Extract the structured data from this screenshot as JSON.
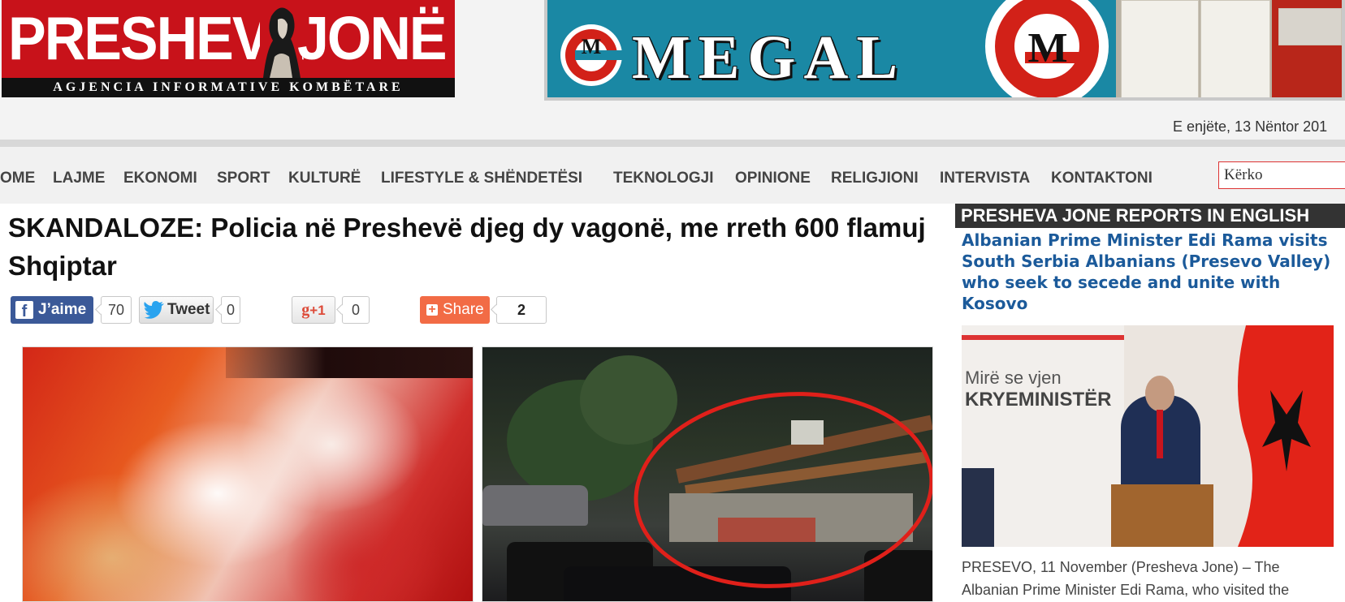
{
  "header": {
    "logo_left": "PRESHEVA",
    "logo_right": "JONË",
    "logo_subtitle": "AGJENCIA INFORMATIVE KOMBËTARE",
    "banner_text": "MEGAL",
    "date": "E enjëte, 13 Nëntor 201"
  },
  "nav": {
    "items": [
      {
        "label": "OME"
      },
      {
        "label": "LAJME"
      },
      {
        "label": "EKONOMI"
      },
      {
        "label": "SPORT"
      },
      {
        "label": "KULTURË"
      },
      {
        "label": "LIFESTYLE & SHËNDETËSI"
      },
      {
        "label": "TEKNOLOGJI"
      },
      {
        "label": "OPINIONE"
      },
      {
        "label": "RELIGJIONI"
      },
      {
        "label": "INTERVISTA"
      },
      {
        "label": "KONTAKTONI"
      }
    ],
    "search_placeholder": "Kërko"
  },
  "article": {
    "title": "SKANDALOZE: Policia në Preshevë djeg dy vagonë, me rreth 600 flamuj Shqiptar",
    "share": {
      "facebook_label": "J’aime",
      "facebook_count": "70",
      "twitter_label": "Tweet",
      "twitter_count": "0",
      "gplus_label": "+1",
      "gplus_count": "0",
      "share_label": "Share",
      "share_count": "2"
    }
  },
  "sidebar": {
    "heading": "PRESHEVA JONE REPORTS IN ENGLISH",
    "story_title": "Albanian Prime Minister Edi Rama visits South Serbia Albanians (Presevo Valley) who seek to secede and unite with Kosovo",
    "photo_text_1": "Mirë se vjen",
    "photo_text_2": "KRYEMINISTËR",
    "caption": "PRESEVO, 11 November (Presheva Jone) – The Albanian Prime Minister Edi Rama, who visited the"
  },
  "colors": {
    "brand_red": "#c8121a",
    "banner_blue": "#1a88a4",
    "link_blue": "#1b5a9a",
    "facebook_blue": "#3b5998",
    "share_orange": "#f26b45"
  }
}
